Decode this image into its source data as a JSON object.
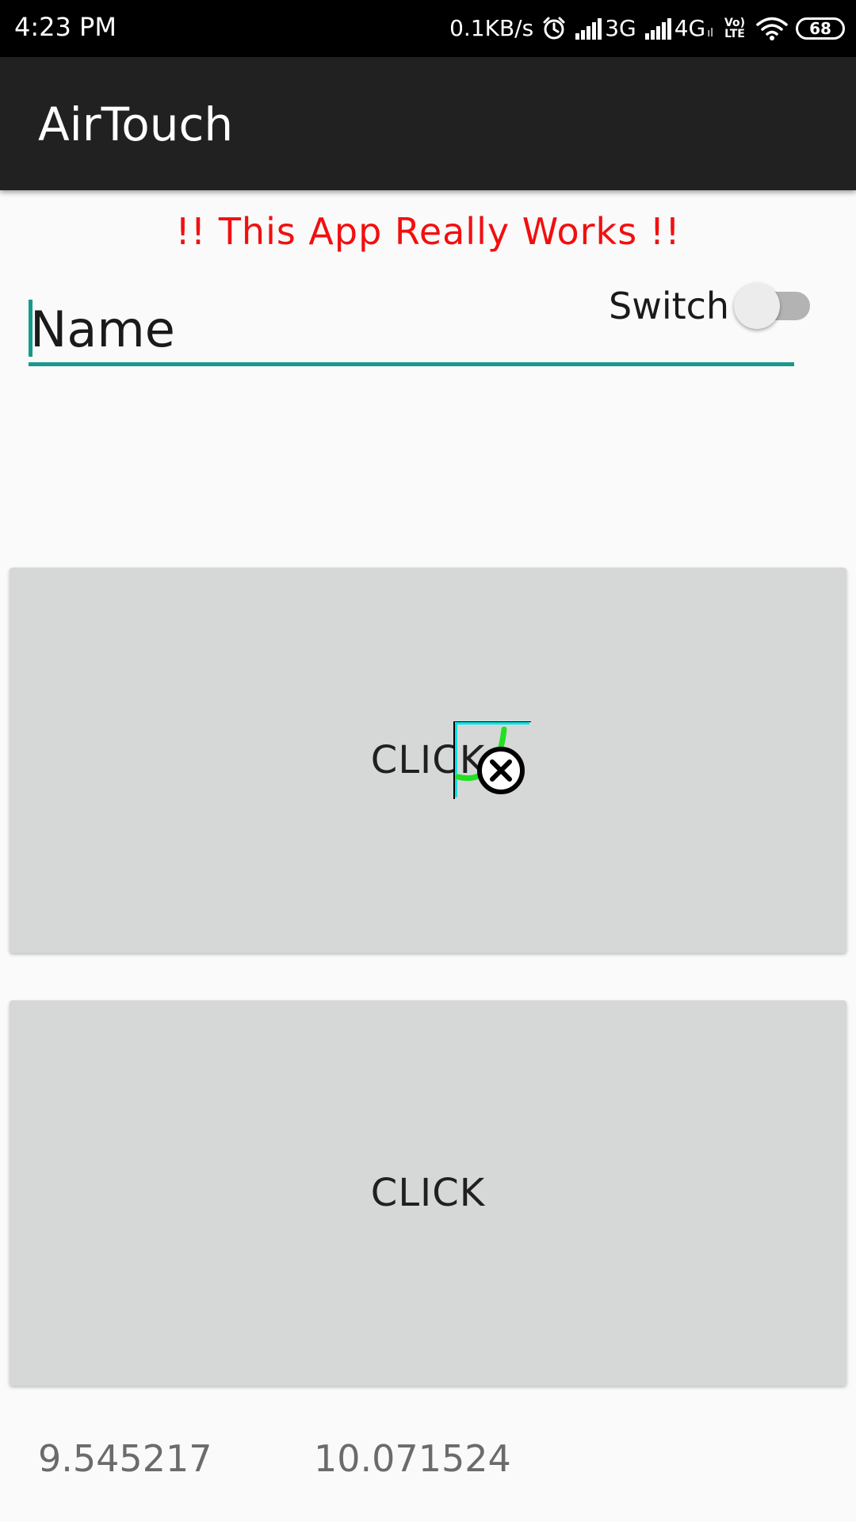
{
  "status_bar": {
    "time": "4:23 PM",
    "net_speed": "0.1KB/s",
    "sim1_label": "3G",
    "sim2_label": "4G",
    "sim2_sub": "ıl",
    "volte_line1": "Vo)",
    "volte_line2": "LTE",
    "battery": "68",
    "icons": [
      "alarm-icon",
      "signal-icon",
      "signal-icon",
      "volte-icon",
      "wifi-icon",
      "battery-icon"
    ]
  },
  "app_bar": {
    "title": "AirTouch"
  },
  "banner": {
    "text": "!! This App Really Works !!",
    "color": "#f20f0f"
  },
  "name_field": {
    "placeholder": "Name",
    "accent": "#159a8c"
  },
  "switch": {
    "label": "Switch",
    "state": "off"
  },
  "buttons": [
    {
      "label": "CLICK"
    },
    {
      "label": "CLICK"
    }
  ],
  "readouts": {
    "x": "9.545217",
    "y": "10.071524"
  },
  "colors": {
    "app_bar": "#212121",
    "background": "#fafafa",
    "button": "#d6d7d7"
  }
}
